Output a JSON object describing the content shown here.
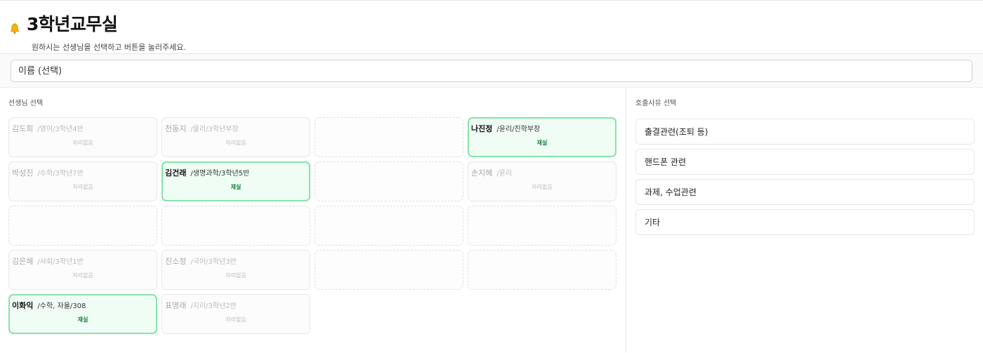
{
  "header": {
    "title": "3학년교무실",
    "subtitle": "원하시는 선생님을 선택하고 버튼을 눌러주세요."
  },
  "search": {
    "placeholder": "이름 (선택)"
  },
  "teachers": {
    "section_label": "선생님 선택",
    "cards": [
      {
        "name": "김도희",
        "info": "/영어/3학년4반",
        "status": "자리없음",
        "present": false,
        "empty": false
      },
      {
        "name": "천동지",
        "info": "/물리/3학년부장",
        "status": "자리없음",
        "present": false,
        "empty": false
      },
      {
        "name": "",
        "info": "",
        "status": "",
        "present": false,
        "empty": true
      },
      {
        "name": "나진정",
        "info": "/윤리/진학부장",
        "status": "재실",
        "present": true,
        "empty": false
      },
      {
        "name": "박성진",
        "info": "/수학/3학년7반",
        "status": "자리없음",
        "present": false,
        "empty": false
      },
      {
        "name": "김건래",
        "info": "/생명과학/3학년5반",
        "status": "재실",
        "present": true,
        "empty": false
      },
      {
        "name": "",
        "info": "",
        "status": "",
        "present": false,
        "empty": true
      },
      {
        "name": "손지혜",
        "info": "/윤리",
        "status": "자리없음",
        "present": false,
        "empty": false
      },
      {
        "name": "",
        "info": "",
        "status": "",
        "present": false,
        "empty": true
      },
      {
        "name": "",
        "info": "",
        "status": "",
        "present": false,
        "empty": true
      },
      {
        "name": "",
        "info": "",
        "status": "",
        "present": false,
        "empty": true
      },
      {
        "name": "",
        "info": "",
        "status": "",
        "present": false,
        "empty": true
      },
      {
        "name": "김은혜",
        "info": "/사회/3학년1반",
        "status": "자리없음",
        "present": false,
        "empty": false
      },
      {
        "name": "진소정",
        "info": "/국어/3학년3반",
        "status": "자리없음",
        "present": false,
        "empty": false
      },
      {
        "name": "",
        "info": "",
        "status": "",
        "present": false,
        "empty": true
      },
      {
        "name": "",
        "info": "",
        "status": "",
        "present": false,
        "empty": true
      },
      {
        "name": "이화익",
        "info": "/수학, 자율/308",
        "status": "재실",
        "present": true,
        "empty": false
      },
      {
        "name": "표명래",
        "info": "/지리/3학년2반",
        "status": "자리없음",
        "present": false,
        "empty": false
      }
    ]
  },
  "reasons": {
    "section_label": "호출사유 선택",
    "items": [
      {
        "label": "출결관련(조퇴 등)"
      },
      {
        "label": "핸드폰 관련"
      },
      {
        "label": "과제, 수업관련"
      },
      {
        "label": "기타"
      }
    ]
  },
  "colors": {
    "present_border": "#86e3a8",
    "present_bg": "#f0fdf4",
    "present_status": "#15803d"
  }
}
